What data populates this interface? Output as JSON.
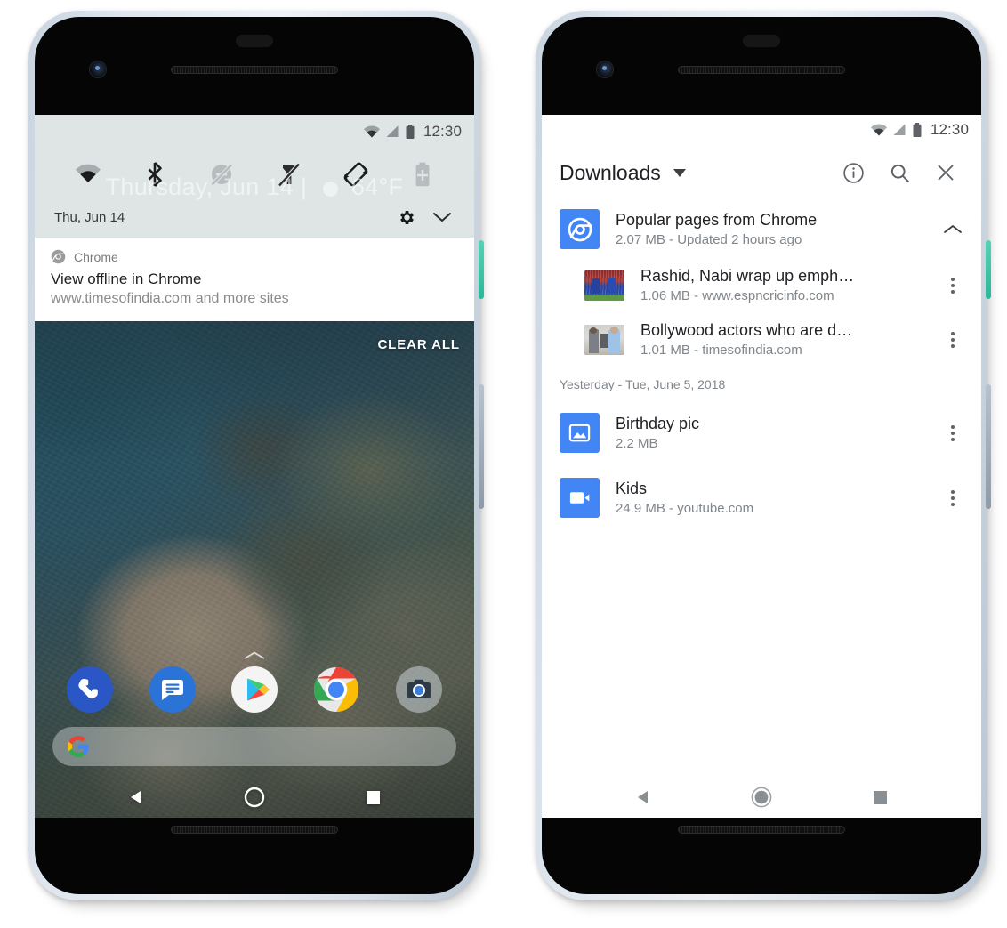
{
  "meta": {
    "accent_blue": "#4285f4",
    "qs_panel_bg": "#dfe4e5",
    "power_button_color": "#3dc6a6"
  },
  "left_phone": {
    "status_bar": {
      "time": "12:30",
      "icons": [
        "wifi-icon",
        "signal-icon",
        "battery-icon"
      ]
    },
    "quick_settings": {
      "tiles": [
        {
          "name": "wifi-tile",
          "label": "Wi-Fi",
          "state": "on"
        },
        {
          "name": "bluetooth-tile",
          "label": "Bluetooth",
          "state": "on"
        },
        {
          "name": "do-not-disturb-tile",
          "label": "Do Not Disturb",
          "state": "off"
        },
        {
          "name": "flashlight-tile",
          "label": "Flashlight",
          "state": "off"
        },
        {
          "name": "auto-rotate-tile",
          "label": "Auto-rotate",
          "state": "on"
        },
        {
          "name": "battery-saver-tile",
          "label": "Battery Saver",
          "state": "off"
        }
      ],
      "date": "Thu, Jun 14",
      "ghost_widget": {
        "date": "Thursday, Jun 14",
        "separator": "|",
        "temperature": "64°F"
      },
      "settings_icon": "gear-icon",
      "expand_icon": "chevron-down-icon"
    },
    "notification": {
      "app_name": "Chrome",
      "app_icon": "chrome-icon",
      "title": "View offline in Chrome",
      "subtitle": "www.timesofindia.com and more sites"
    },
    "clear_all_label": "CLEAR ALL",
    "dock": [
      {
        "name": "phone-app-icon",
        "label": "Phone"
      },
      {
        "name": "messages-app-icon",
        "label": "Messages"
      },
      {
        "name": "play-store-app-icon",
        "label": "Play Store"
      },
      {
        "name": "chrome-app-icon",
        "label": "Chrome"
      },
      {
        "name": "camera-app-icon",
        "label": "Camera"
      }
    ],
    "search_bar": {
      "icon": "google-g-icon",
      "placeholder": ""
    },
    "nav_bar": [
      {
        "name": "nav-back-button",
        "label": "Back"
      },
      {
        "name": "nav-home-button",
        "label": "Home"
      },
      {
        "name": "nav-recents-button",
        "label": "Recents"
      }
    ]
  },
  "right_phone": {
    "status_bar": {
      "time": "12:30",
      "icons": [
        "wifi-icon",
        "signal-icon",
        "battery-icon"
      ]
    },
    "app_bar": {
      "title": "Downloads",
      "dropdown_icon": "caret-down-icon",
      "actions": [
        {
          "name": "info-button",
          "icon": "info-circle-icon",
          "label": "Info"
        },
        {
          "name": "search-button",
          "icon": "search-icon",
          "label": "Search"
        },
        {
          "name": "close-button",
          "icon": "close-icon",
          "label": "Close"
        }
      ]
    },
    "groups": [
      {
        "name": "Popular pages from Chrome",
        "meta": "2.07 MB - Updated 2 hours ago",
        "icon": "chrome-folder-icon",
        "expanded": true,
        "collapse_icon": "chevron-up-icon",
        "items": [
          {
            "title": "Rashid, Nabi wrap up emph…",
            "meta": "1.06 MB - www.espncricinfo.com",
            "thumb": "cricket-thumbnail",
            "overflow_icon": "more-vert-icon"
          },
          {
            "title": "Bollywood actors who are d…",
            "meta": "1.01 MB - timesofindia.com",
            "thumb": "bollywood-thumbnail",
            "overflow_icon": "more-vert-icon"
          }
        ]
      }
    ],
    "section_header": "Yesterday - Tue, June 5, 2018",
    "files": [
      {
        "title": "Birthday pic",
        "meta": "2.2 MB",
        "icon": "image-file-icon",
        "overflow_icon": "more-vert-icon"
      },
      {
        "title": "Kids",
        "meta": "24.9 MB - youtube.com",
        "icon": "video-file-icon",
        "overflow_icon": "more-vert-icon"
      }
    ],
    "nav_bar": [
      {
        "name": "nav-back-button",
        "label": "Back"
      },
      {
        "name": "nav-home-button",
        "label": "Home"
      },
      {
        "name": "nav-recents-button",
        "label": "Recents"
      }
    ]
  }
}
